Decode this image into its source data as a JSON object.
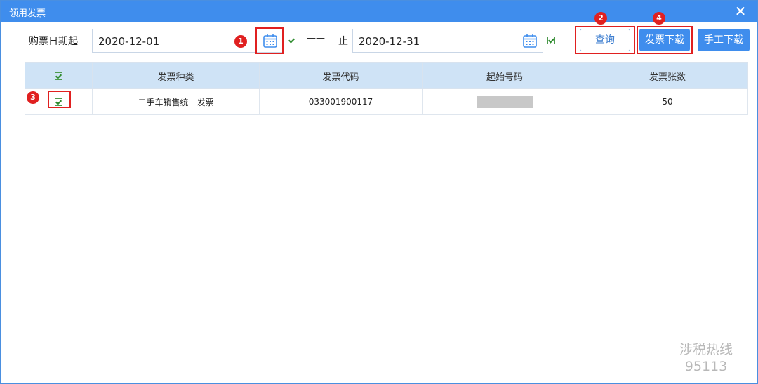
{
  "window": {
    "title": "领用发票",
    "close_glyph": "✕"
  },
  "filter": {
    "start_label": "购票日期起",
    "start_value": "2020-12-01",
    "start_checked": true,
    "separator": "——",
    "end_label": "止",
    "end_value": "2020-12-31",
    "end_checked": true,
    "calendar_icon": "calendar-icon"
  },
  "buttons": {
    "query": "查询",
    "download": "发票下载",
    "manual_download": "手工下载"
  },
  "badges": [
    "1",
    "2",
    "3",
    "4"
  ],
  "table": {
    "headers": [
      "发票种类",
      "发票代码",
      "起始号码",
      "发票张数"
    ],
    "rows": [
      {
        "checked": true,
        "type": "二手车销售统一发票",
        "code": "033001900117",
        "start_no_redacted": true,
        "count": "50"
      }
    ]
  },
  "watermark": {
    "line1": "涉税热线",
    "line2": "95113"
  },
  "colors": {
    "title_bar": "#3f8ded",
    "header_bg": "#cfe3f6",
    "highlight": "#e02020",
    "primary": "#3f8ded"
  }
}
